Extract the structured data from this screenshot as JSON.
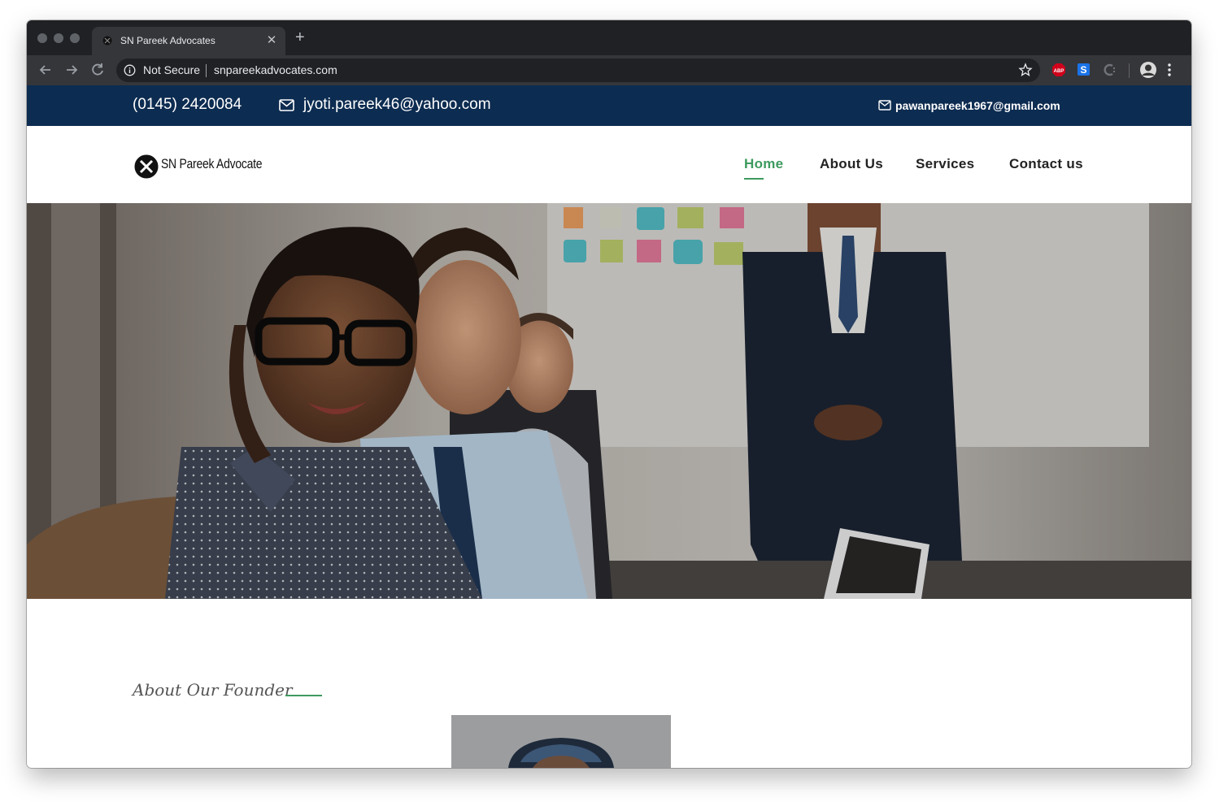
{
  "browser": {
    "tab_title": "SN Pareek Advocates",
    "tab_close": "✕",
    "new_tab": "+",
    "security_label": "Not Secure",
    "url": "snpareekadvocates.com"
  },
  "topbar": {
    "phone": "(0145) 2420084",
    "email_primary": "jyoti.pareek46@yahoo.com",
    "email_secondary": "pawanpareek1967@gmail.com"
  },
  "header": {
    "logo_text": "SN Pareek Advocate",
    "nav": [
      {
        "label": "Home",
        "active": true
      },
      {
        "label": "About Us",
        "active": false
      },
      {
        "label": "Services",
        "active": false
      },
      {
        "label": "Contact us",
        "active": false
      }
    ]
  },
  "about": {
    "heading": "About Our Founder"
  },
  "colors": {
    "topbar_bg": "#0d2c51",
    "accent_green": "#3d9a5f",
    "chrome_dark": "#202124",
    "chrome_toolbar": "#35363a"
  },
  "icons": [
    "back-arrow-icon",
    "forward-arrow-icon",
    "reload-icon",
    "info-icon",
    "star-icon",
    "abp-extension-icon",
    "s-extension-icon",
    "c-extension-icon",
    "profile-avatar-icon",
    "menu-dots-icon",
    "envelope-icon"
  ]
}
